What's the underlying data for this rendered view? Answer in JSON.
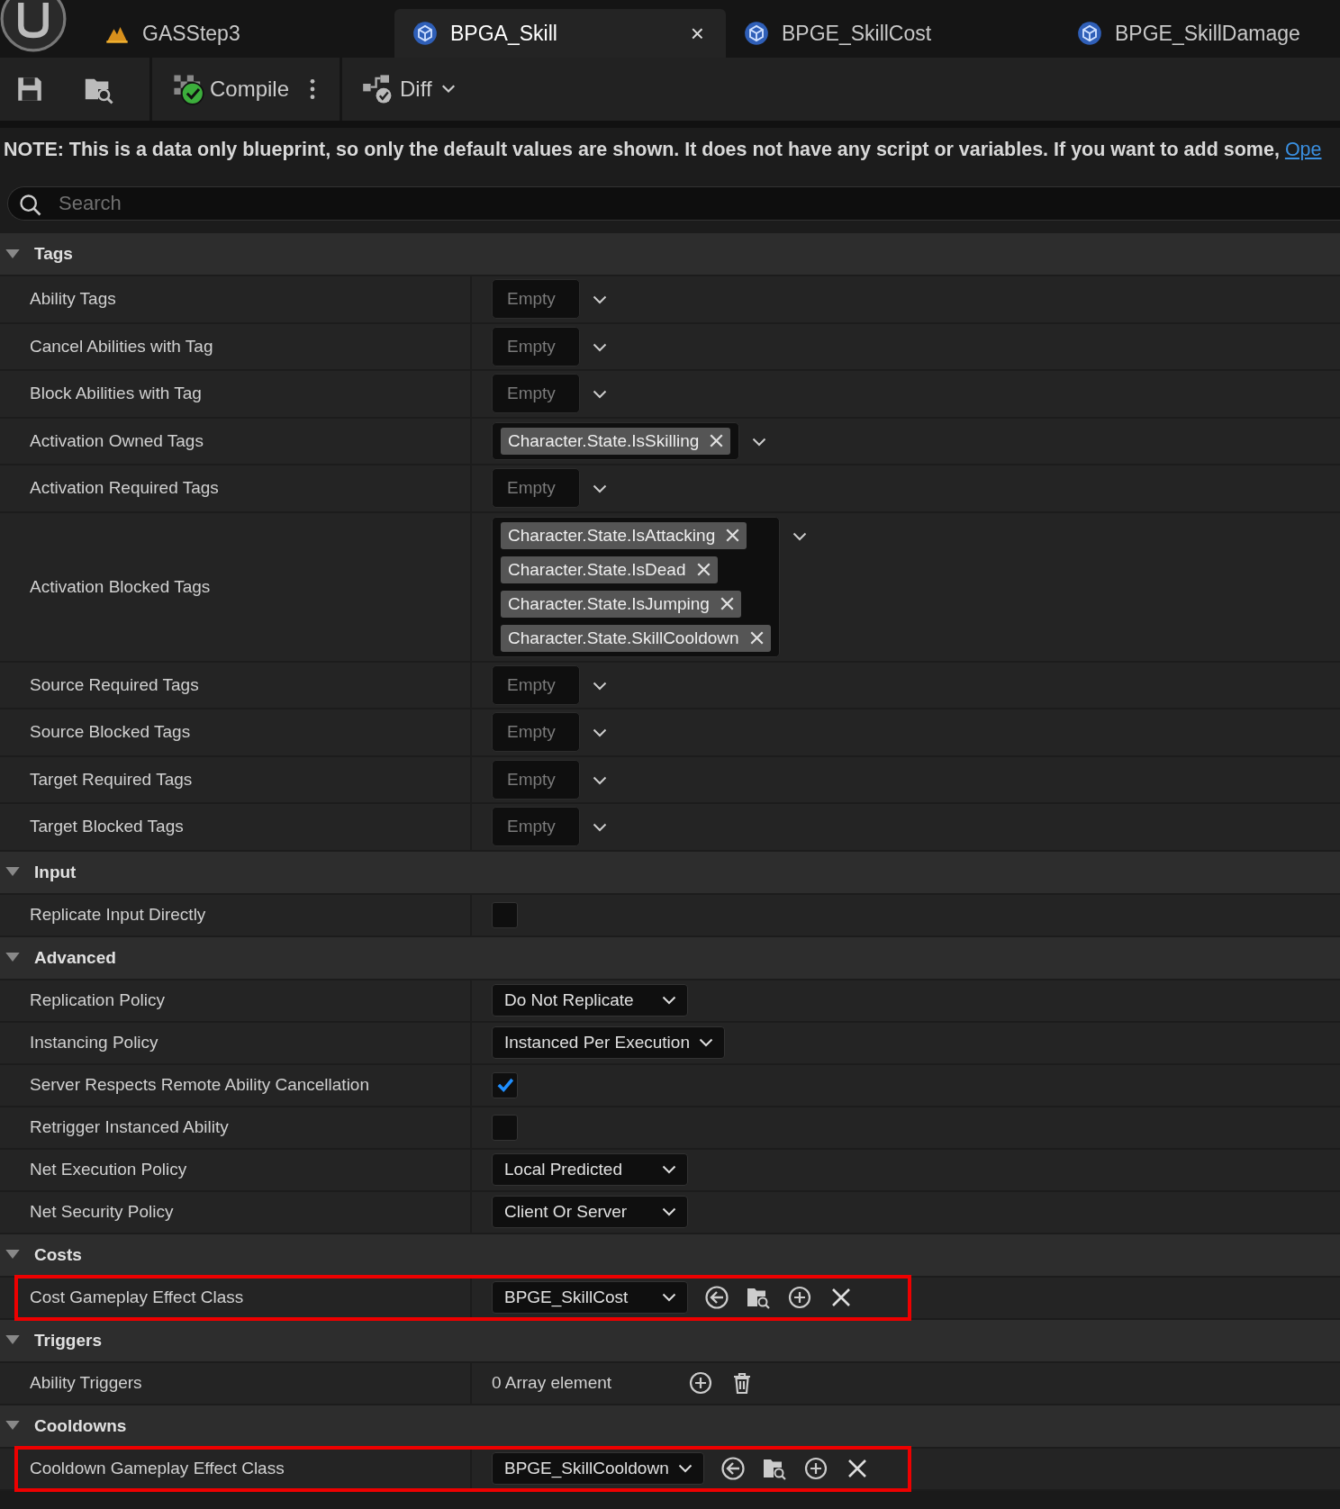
{
  "tabs": [
    {
      "label": "GASStep3",
      "selected": false
    },
    {
      "label": "BPGA_Skill",
      "selected": true,
      "close": "×"
    },
    {
      "label": "BPGE_SkillCost",
      "selected": false
    },
    {
      "label": "BPGE_SkillDamage",
      "selected": false
    }
  ],
  "toolbar": {
    "compile": "Compile",
    "diff": "Diff"
  },
  "note": {
    "text": "NOTE: This is a data only blueprint, so only the default values are shown.  It does not have any script or variables.  If you want to add some, ",
    "link": "Ope"
  },
  "search": {
    "placeholder": "Search"
  },
  "sections": [
    {
      "title": "Tags",
      "expanded": true,
      "rows": [
        {
          "label": "Ability Tags",
          "kind": "tags",
          "empty": "Empty",
          "tags": []
        },
        {
          "label": "Cancel Abilities with Tag",
          "kind": "tags",
          "empty": "Empty",
          "tags": []
        },
        {
          "label": "Block Abilities with Tag",
          "kind": "tags",
          "empty": "Empty",
          "tags": []
        },
        {
          "label": "Activation Owned Tags",
          "kind": "tags",
          "tags": [
            "Character.State.IsSkilling"
          ]
        },
        {
          "label": "Activation Required Tags",
          "kind": "tags",
          "empty": "Empty",
          "tags": []
        },
        {
          "label": "Activation Blocked Tags",
          "kind": "tags",
          "tags": [
            "Character.State.IsAttacking",
            "Character.State.IsDead",
            "Character.State.IsJumping",
            "Character.State.SkillCooldown"
          ]
        },
        {
          "label": "Source Required Tags",
          "kind": "tags",
          "empty": "Empty",
          "tags": []
        },
        {
          "label": "Source Blocked Tags",
          "kind": "tags",
          "empty": "Empty",
          "tags": []
        },
        {
          "label": "Target Required Tags",
          "kind": "tags",
          "empty": "Empty",
          "tags": []
        },
        {
          "label": "Target Blocked Tags",
          "kind": "tags",
          "empty": "Empty",
          "tags": []
        }
      ]
    },
    {
      "title": "Input",
      "expanded": true,
      "rows": [
        {
          "label": "Replicate Input Directly",
          "kind": "checkbox",
          "checked": false
        }
      ]
    },
    {
      "title": "Advanced",
      "expanded": true,
      "rows": [
        {
          "label": "Replication Policy",
          "kind": "dropdown",
          "value": "Do Not Replicate"
        },
        {
          "label": "Instancing Policy",
          "kind": "dropdown",
          "value": "Instanced Per Execution"
        },
        {
          "label": "Server Respects Remote Ability Cancellation",
          "kind": "checkbox",
          "checked": true
        },
        {
          "label": "Retrigger Instanced Ability",
          "kind": "checkbox",
          "checked": false
        },
        {
          "label": "Net Execution Policy",
          "kind": "dropdown",
          "value": "Local Predicted"
        },
        {
          "label": "Net Security Policy",
          "kind": "dropdown",
          "value": "Client Or Server"
        }
      ]
    },
    {
      "title": "Costs",
      "expanded": true,
      "rows": [
        {
          "label": "Cost Gameplay Effect Class",
          "kind": "class",
          "value": "BPGE_SkillCost",
          "highlighted": true
        }
      ]
    },
    {
      "title": "Triggers",
      "expanded": true,
      "rows": [
        {
          "label": "Ability Triggers",
          "kind": "array",
          "value": "0 Array element"
        }
      ]
    },
    {
      "title": "Cooldowns",
      "expanded": true,
      "rows": [
        {
          "label": "Cooldown Gameplay Effect Class",
          "kind": "class",
          "value": "BPGE_SkillCooldown",
          "highlighted": true
        }
      ]
    }
  ]
}
